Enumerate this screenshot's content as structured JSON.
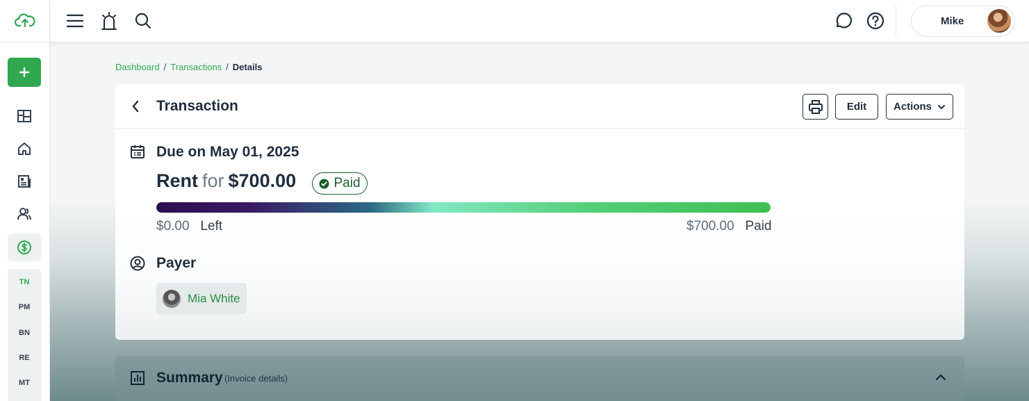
{
  "topbar": {
    "user_name": "Mike"
  },
  "sidebar": {
    "sub_items": [
      "TN",
      "PM",
      "BN",
      "RE",
      "MT"
    ],
    "active_sub": "TN"
  },
  "breadcrumb": {
    "items": [
      "Dashboard",
      "Transactions"
    ],
    "current": "Details",
    "separator": "/"
  },
  "card": {
    "title": "Transaction",
    "edit_label": "Edit",
    "actions_label": "Actions",
    "due_text": "Due on May 01, 2025",
    "category": "Rent",
    "for_word": "for",
    "amount": "$700.00",
    "status": "Paid",
    "progress_fraction": 1.0,
    "left_amount": "$0.00",
    "left_label": "Left",
    "paid_amount": "$700.00",
    "paid_label": "Paid",
    "payer_title": "Payer",
    "payer_name": "Mia White"
  },
  "summary": {
    "title": "Summary",
    "subtitle": "(Invoice details)"
  },
  "colors": {
    "accent": "#2fa84f",
    "text": "#1f2d3d",
    "paid": "#1b5e2e"
  }
}
